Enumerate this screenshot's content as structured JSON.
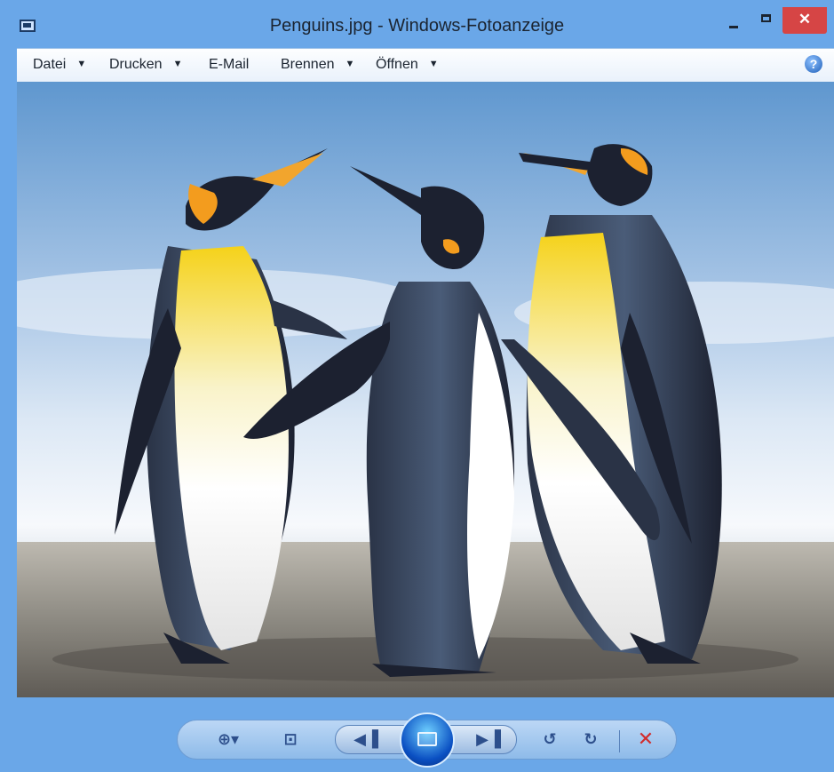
{
  "window": {
    "title": "Penguins.jpg - Windows-Fotoanzeige",
    "controls": {
      "minimize": "–",
      "maximize": "☐",
      "close": "✕"
    }
  },
  "menu": {
    "items": [
      {
        "label": "Datei",
        "has_dropdown": true
      },
      {
        "label": "Drucken",
        "has_dropdown": true
      },
      {
        "label": "E-Mail",
        "has_dropdown": false
      },
      {
        "label": "Brennen",
        "has_dropdown": true
      },
      {
        "label": "Öffnen",
        "has_dropdown": true
      }
    ],
    "caret": "▼",
    "help_label": "?"
  },
  "photo": {
    "subject": "three emperor penguins on a beach",
    "colors": {
      "sky": "#a7c6e8",
      "surf": "#f4f7fb",
      "sand": "#8f8f89",
      "penguin_dark": "#1c2130",
      "penguin_gray": "#3a4a62",
      "belly": "#f2f2f2",
      "yellow": "#f1c21b",
      "orange": "#f39c1e"
    }
  },
  "toolbar": {
    "zoom": "⊕▾",
    "fit": "⊡",
    "prev": "◀▐",
    "next": "▶▐",
    "rotate_ccw": "↺",
    "rotate_cw": "↻",
    "delete": "✕"
  }
}
